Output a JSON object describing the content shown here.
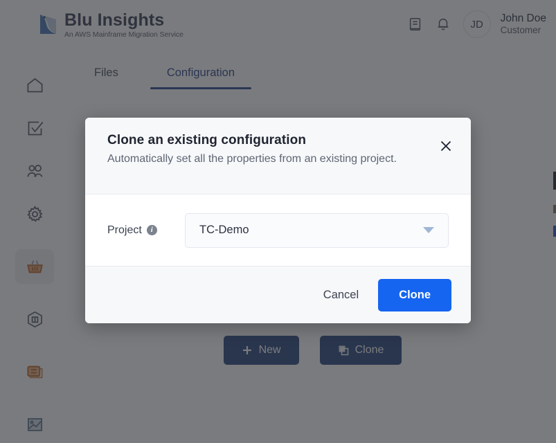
{
  "brand": {
    "title": "Blu Insights",
    "subtitle": "An AWS Mainframe Migration Service",
    "logo_icon": "blu-insights-logo",
    "logo_color": "#3f6fb5"
  },
  "topbar": {
    "icons": [
      {
        "name": "docs-icon",
        "glyph": "book"
      },
      {
        "name": "notifications-bell-icon",
        "glyph": "bell"
      }
    ],
    "user": {
      "initials": "JD",
      "name": "John Doe",
      "role": "Customer"
    }
  },
  "sidebar": {
    "items": [
      {
        "name": "sidebar-item-home",
        "icon": "home-icon",
        "active": false
      },
      {
        "name": "sidebar-item-tasks",
        "icon": "checkbox-icon",
        "active": false
      },
      {
        "name": "sidebar-item-users",
        "icon": "users-icon",
        "active": false
      },
      {
        "name": "sidebar-item-settings",
        "icon": "gear-icon",
        "active": false
      },
      {
        "name": "sidebar-item-basket",
        "icon": "basket-icon",
        "active": true
      },
      {
        "name": "sidebar-item-package",
        "icon": "hexagon-package-icon",
        "active": false
      },
      {
        "name": "sidebar-item-database",
        "icon": "database-icon",
        "active": false
      },
      {
        "name": "sidebar-item-chart",
        "icon": "chart-image-icon",
        "active": false
      }
    ]
  },
  "tabs": [
    {
      "label": "Files",
      "active": false
    },
    {
      "label": "Configuration",
      "active": true
    }
  ],
  "page_actions": {
    "new_label": "New",
    "new_icon": "plus-icon",
    "clone_label": "Clone",
    "clone_icon": "copy-icon"
  },
  "modal": {
    "title": "Clone an existing configuration",
    "subtitle": "Automatically set all the properties from an existing project.",
    "close_icon": "close-icon",
    "field": {
      "label": "Project",
      "info_icon": "info-icon",
      "info_glyph": "i",
      "value": "TC-Demo",
      "caret_icon": "chevron-down-icon"
    },
    "cancel_label": "Cancel",
    "confirm_label": "Clone"
  },
  "colors": {
    "primary_blue": "#1565f0",
    "tab_active": "#2e4a8f",
    "dark_button": "#2f4a82",
    "overlay": "rgba(40,42,46,0.62)",
    "header_bg": "#f7f8fa"
  }
}
